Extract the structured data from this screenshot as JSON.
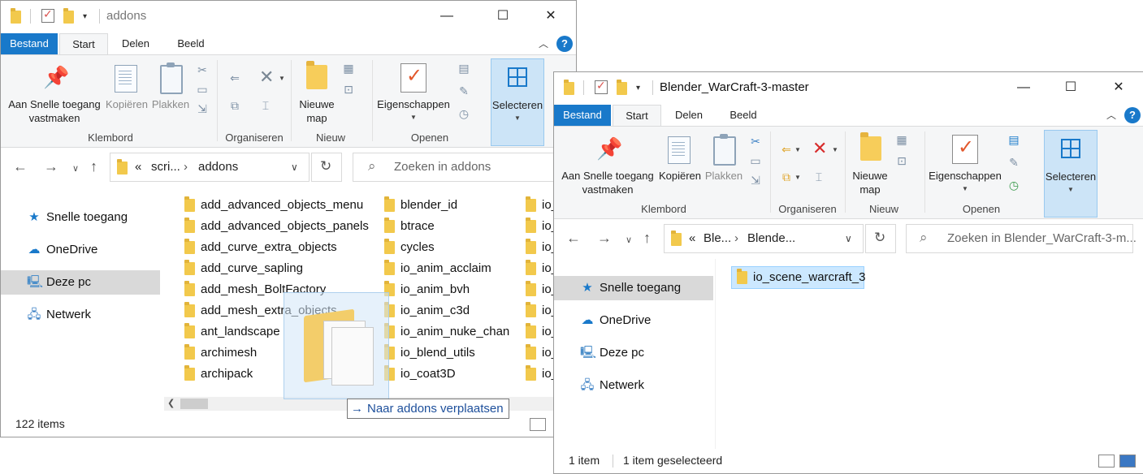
{
  "windowA": {
    "title": "addons",
    "tabs": [
      "Bestand",
      "Start",
      "Delen",
      "Beeld"
    ],
    "ribbon": {
      "pin_label": "Aan Snelle toegang vastmaken",
      "copy_label": "Kopiëren",
      "paste_label": "Plakken",
      "new_folder_label": "Nieuwe map",
      "properties_label": "Eigenschappen",
      "select_label": "Selecteren",
      "groups": [
        "Klembord",
        "Organiseren",
        "Nieuw",
        "Openen"
      ]
    },
    "address": {
      "prefix": "«",
      "segments": [
        "scri...",
        "addons"
      ]
    },
    "search": {
      "placeholder": "Zoeken in addons"
    },
    "nav": [
      "Snelle toegang",
      "OneDrive",
      "Deze pc",
      "Netwerk"
    ],
    "files": {
      "col1": [
        "add_advanced_objects_menu",
        "add_advanced_objects_panels",
        "add_curve_extra_objects",
        "add_curve_sapling",
        "add_mesh_BoltFactory",
        "add_mesh_extra_objects",
        "ant_landscape",
        "archimesh",
        "archipack"
      ],
      "col2": [
        "blender_id",
        "btrace",
        "cycles",
        "io_anim_acclaim",
        "io_anim_bvh",
        "io_anim_c3d",
        "io_anim_nuke_chan",
        "io_blend_utils",
        "io_coat3D"
      ],
      "col3": [
        "io_",
        "io_",
        "io_",
        "io_",
        "io_",
        "io_",
        "io_",
        "io_",
        "io_"
      ]
    },
    "status": "122 items",
    "tooltip": "Naar addons verplaatsen"
  },
  "windowB": {
    "title": "Blender_WarCraft-3-master",
    "tabs": [
      "Bestand",
      "Start",
      "Delen",
      "Beeld"
    ],
    "ribbon": {
      "pin_label": "Aan Snelle toegang vastmaken",
      "copy_label": "Kopiëren",
      "paste_label": "Plakken",
      "new_folder_label": "Nieuwe map",
      "properties_label": "Eigenschappen",
      "select_label": "Selecteren",
      "groups": [
        "Klembord",
        "Organiseren",
        "Nieuw",
        "Openen"
      ]
    },
    "address": {
      "prefix": "«",
      "segments": [
        "Ble...",
        "Blende..."
      ]
    },
    "search": {
      "placeholder": "Zoeken in Blender_WarCraft-3-m..."
    },
    "nav": [
      "Snelle toegang",
      "OneDrive",
      "Deze pc",
      "Netwerk"
    ],
    "files": [
      "io_scene_warcraft_3"
    ],
    "status_count": "1 item",
    "status_selected": "1 item geselecteerd"
  },
  "colors": {
    "accent": "#1979ca",
    "folder": "#f2c94c",
    "selection": "#cce8ff"
  }
}
